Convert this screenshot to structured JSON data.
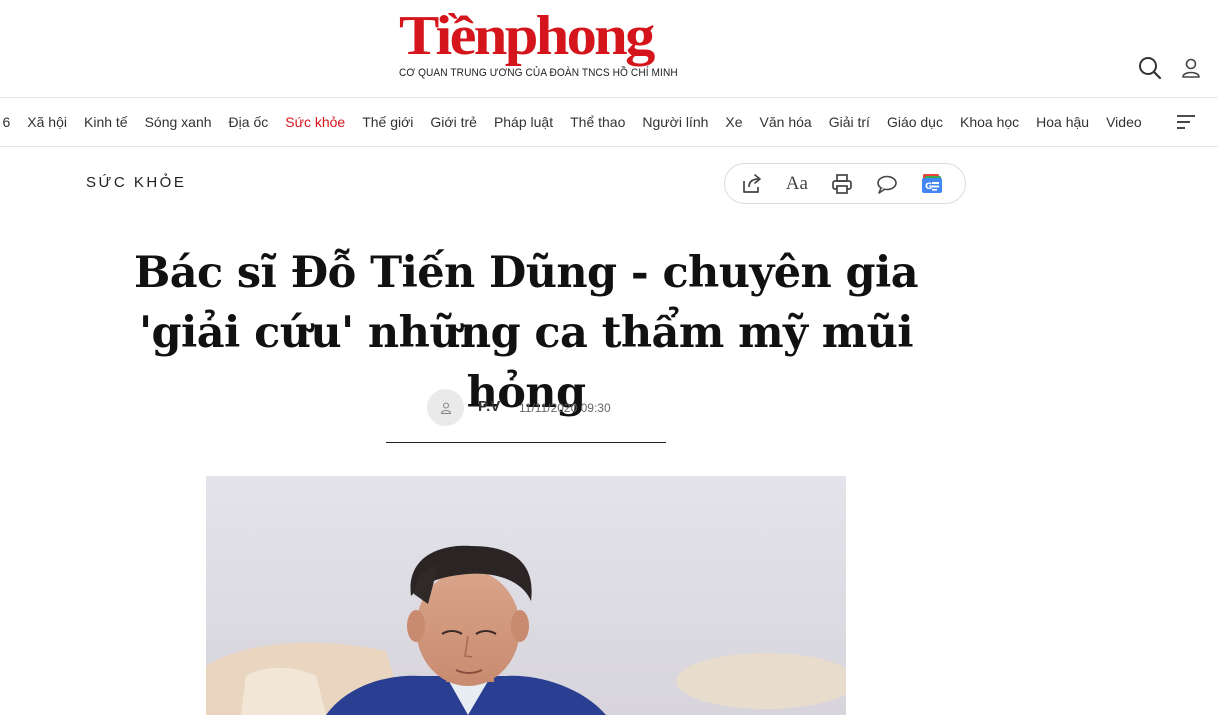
{
  "header": {
    "logo_text": "Tiềnphong",
    "tagline": "CƠ QUAN TRUNG ƯƠNG CỦA ĐOÀN TNCS HỒ CHÍ MINH",
    "brand_color": "#d4161c",
    "icons": [
      "search-icon",
      "user-icon"
    ]
  },
  "nav": {
    "items": [
      {
        "label": "6"
      },
      {
        "label": "Xã hội"
      },
      {
        "label": "Kinh tế"
      },
      {
        "label": "Sóng xanh"
      },
      {
        "label": "Địa ốc"
      },
      {
        "label": "Sức khỏe"
      },
      {
        "label": "Thế giới"
      },
      {
        "label": "Giới trẻ"
      },
      {
        "label": "Pháp luật"
      },
      {
        "label": "Thể thao"
      },
      {
        "label": "Người lính"
      },
      {
        "label": "Xe"
      },
      {
        "label": "Văn hóa"
      },
      {
        "label": "Giải trí"
      },
      {
        "label": "Giáo dục"
      },
      {
        "label": "Khoa học"
      },
      {
        "label": "Hoa hậu"
      },
      {
        "label": "Video"
      }
    ],
    "active": "Sức khỏe",
    "menu_icon": "hamburger-menu-icon"
  },
  "article": {
    "category": "SỨC KHỎE",
    "headline": "Bác sĩ Đỗ Tiến Dũng - chuyên gia 'giải cứu' những ca thẩm mỹ mũi hỏng",
    "author": "P.V",
    "date": "11/11/2020 09:30",
    "toolbar": {
      "font_size_label": "Aa",
      "icons": [
        "share-icon",
        "font-size-icon",
        "print-icon",
        "comment-icon",
        "google-news-icon"
      ]
    }
  }
}
